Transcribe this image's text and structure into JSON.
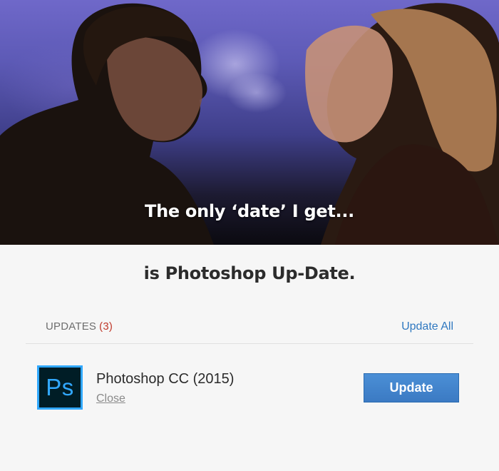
{
  "meme": {
    "top_caption": "The only ‘date’ I get...",
    "bottom_caption": "is Photoshop Up-Date."
  },
  "updates": {
    "heading": "UPDATES",
    "count": "(3)",
    "update_all_label": "Update All"
  },
  "app": {
    "icon_text": "Ps",
    "name": "Photoshop CC (2015)",
    "close_label": "Close",
    "update_label": "Update"
  },
  "colors": {
    "accent_blue": "#2f78c0",
    "count_red": "#c0392b",
    "ps_brand_blue": "#31a8ff",
    "ps_brand_dark": "#001d26"
  }
}
